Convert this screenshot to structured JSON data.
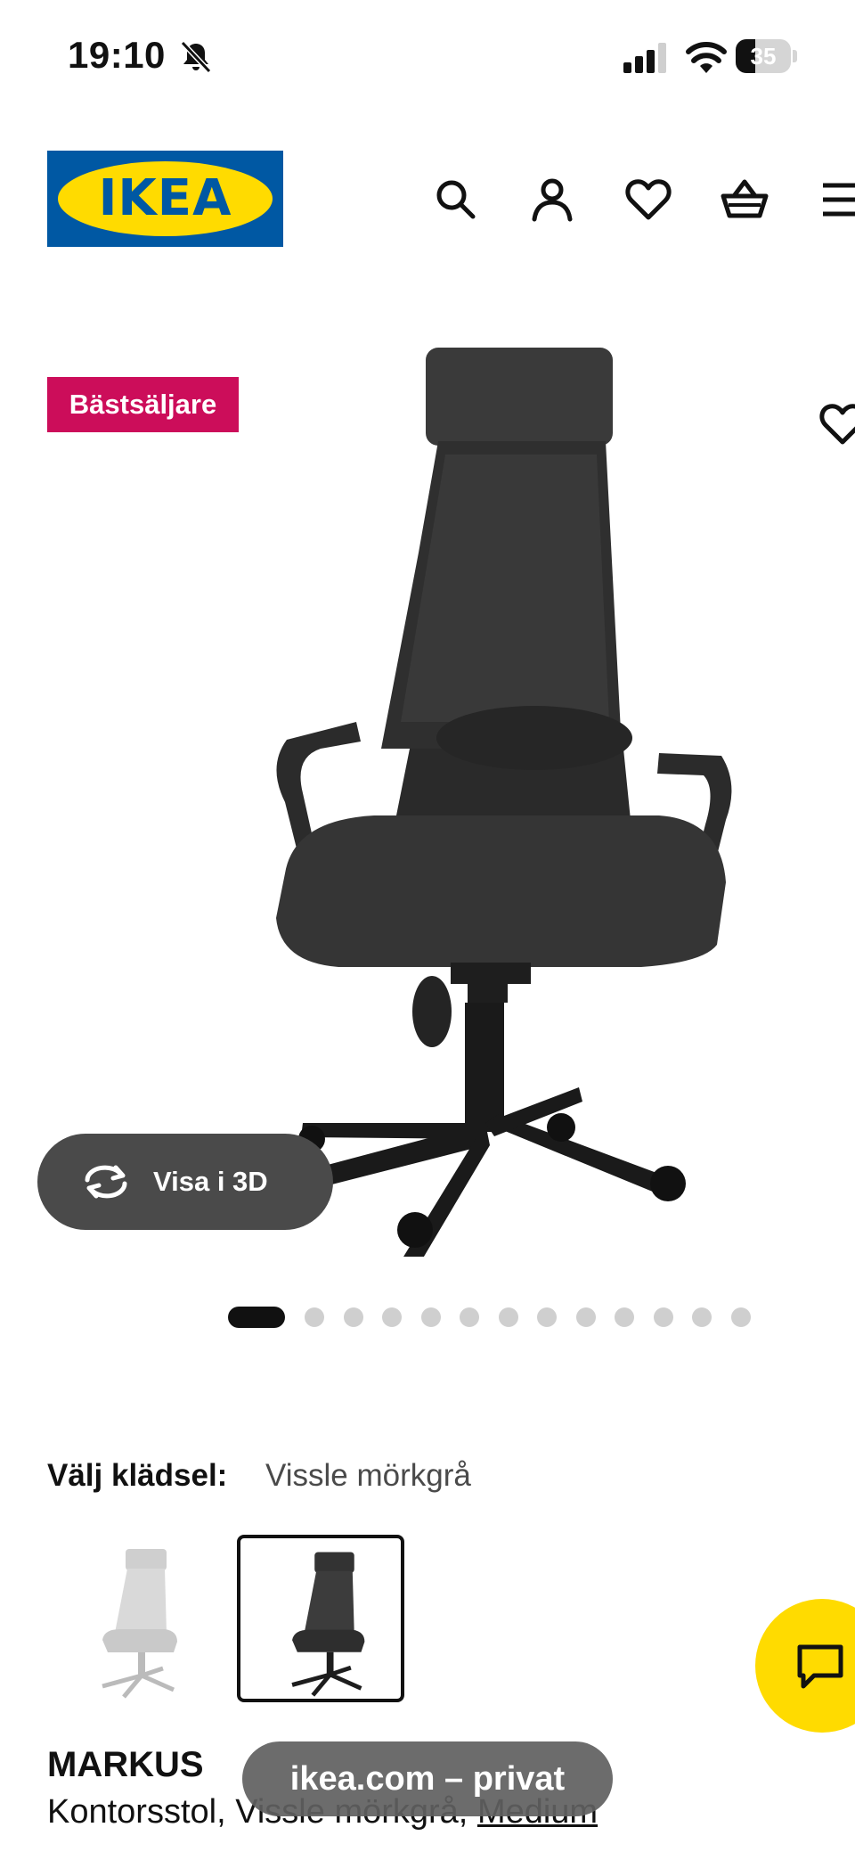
{
  "status_bar": {
    "time": "19:10",
    "battery": "35"
  },
  "header": {
    "logo_text": "IKEA",
    "icons": [
      "search-icon",
      "user-icon",
      "heart-icon",
      "cart-icon",
      "menu-icon"
    ]
  },
  "product_image": {
    "badge": "Bästsäljare",
    "view_3d_label": "Visa i 3D",
    "carousel": {
      "total": 13,
      "active_index": 0
    }
  },
  "upholstery": {
    "label": "Välj klädsel:",
    "value": "Vissle mörkgrå",
    "options": [
      "Vissle ljusgrå",
      "Vissle mörkgrå"
    ],
    "selected_index": 1
  },
  "product": {
    "name": "MARKUS",
    "description": "Kontorsstol, Vissle mörkgrå, ",
    "size_link": "Medium"
  },
  "browser": {
    "url_pill": "ikea.com – privat"
  },
  "colors": {
    "ikea_blue": "#0058a3",
    "ikea_yellow": "#ffdb00",
    "badge_red": "#cc0d5a"
  }
}
